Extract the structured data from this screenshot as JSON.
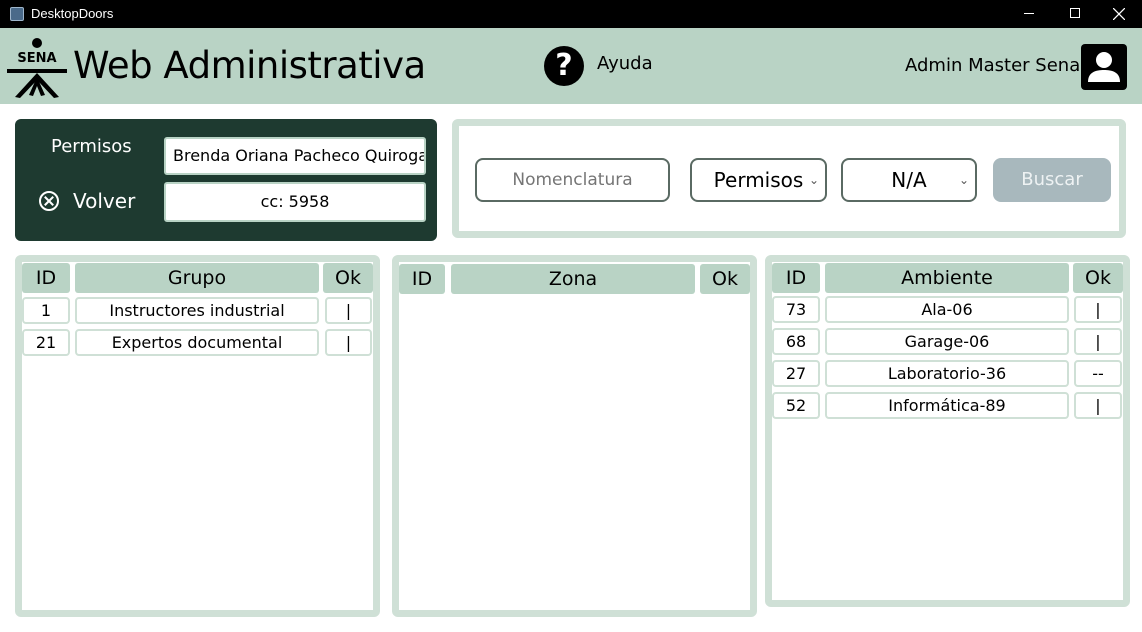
{
  "window": {
    "title": "DesktopDoors"
  },
  "header": {
    "logo_text": "SENA",
    "title": "Web Administrativa",
    "help_label": "Ayuda",
    "user_name": "Admin Master Sena"
  },
  "profile": {
    "permisos_label": "Permisos",
    "back_label": "Volver",
    "name": "Brenda Oriana Pacheco Quiroga",
    "cc": "cc: 5958"
  },
  "search": {
    "nomenclatura_placeholder": "Nomenclatura",
    "type_selected": "Permisos",
    "filter_selected": "N/A",
    "buscar_label": "Buscar"
  },
  "grupos": {
    "headers": {
      "id": "ID",
      "name": "Grupo",
      "ok": "Ok"
    },
    "rows": [
      {
        "id": "1",
        "name": "Instructores industrial",
        "ok": "|"
      },
      {
        "id": "21",
        "name": "Expertos documental",
        "ok": "|"
      }
    ]
  },
  "zonas": {
    "headers": {
      "id": "ID",
      "name": "Zona",
      "ok": "Ok"
    },
    "rows": []
  },
  "ambientes": {
    "headers": {
      "id": "ID",
      "name": "Ambiente",
      "ok": "Ok"
    },
    "rows": [
      {
        "id": "73",
        "name": "Ala-06",
        "ok": "|"
      },
      {
        "id": "68",
        "name": "Garage-06",
        "ok": "|"
      },
      {
        "id": "27",
        "name": "Laboratorio-36",
        "ok": "--"
      },
      {
        "id": "52",
        "name": "Informática-89",
        "ok": "|"
      }
    ]
  },
  "colors": {
    "header_bg": "#b9d3c5",
    "dark_panel": "#1e3a30",
    "panel_border": "#cfe0d6",
    "buscar_bg": "#a8b8bd"
  }
}
